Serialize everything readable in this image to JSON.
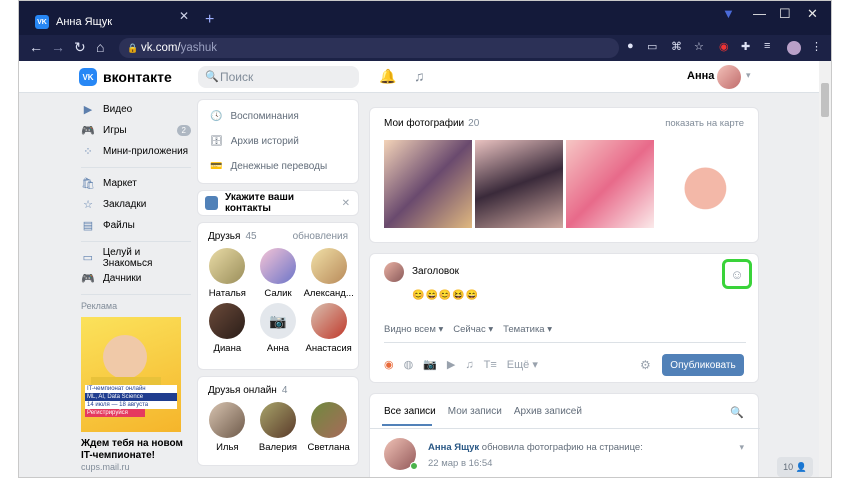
{
  "browser": {
    "tab_title": "Анна Ящук",
    "url_host": "vk.com/",
    "url_path": "yashuk"
  },
  "header": {
    "logo": "вконтакте",
    "search_placeholder": "Поиск",
    "user_name": "Анна"
  },
  "left_menu": {
    "items": [
      {
        "label": "Видео",
        "icon": "video-icon"
      },
      {
        "label": "Игры",
        "icon": "games-icon",
        "badge": "2"
      },
      {
        "label": "Мини-приложения",
        "icon": "apps-icon"
      },
      {
        "label": "Маркет",
        "icon": "market-icon"
      },
      {
        "label": "Закладки",
        "icon": "bookmark-icon"
      },
      {
        "label": "Файлы",
        "icon": "files-icon"
      },
      {
        "label": "Целуй и Знакомься",
        "icon": "community-icon"
      },
      {
        "label": "Дачники",
        "icon": "community-icon"
      }
    ],
    "ad": {
      "heading": "Реклама",
      "title": "Ждем тебя на новом IT-чемпионате!",
      "source": "cups.mail.ru",
      "banner_lines": [
        "IT-чемпионат онлайн",
        "ML, AI, Data Science",
        "14 июля — 18 августа",
        "Регистрируйся"
      ]
    }
  },
  "middle": {
    "menu": [
      "Воспоминания",
      "Архив историй",
      "Денежные переводы"
    ],
    "contacts_label": "Укажите ваши контакты",
    "friends_title": "Друзья",
    "friends_count": "45",
    "friends_updates": "обновления",
    "friends": [
      "Наталья",
      "Салик",
      "Александ...",
      "Диана",
      "Анна",
      "Анастасия"
    ],
    "online_title": "Друзья онлайн",
    "online_count": "4",
    "online": [
      "Илья",
      "Валерия",
      "Светлана"
    ]
  },
  "photos": {
    "title": "Мои фотографии",
    "count": "20",
    "map_link": "показать на карте"
  },
  "post": {
    "title": "Заголовок",
    "emojis": "😊😄😊😆😄",
    "options": [
      "Видно всем ▾",
      "Сейчас ▾",
      "Тематика ▾"
    ],
    "more": "Ещё ▾",
    "publish": "Опубликовать"
  },
  "feed": {
    "tabs": [
      "Все записи",
      "Мои записи",
      "Архив записей"
    ],
    "author": "Анна Ящук",
    "action": " обновила фотографию на странице:",
    "date": "22 мар в 16:54"
  },
  "counter": "10 👤"
}
